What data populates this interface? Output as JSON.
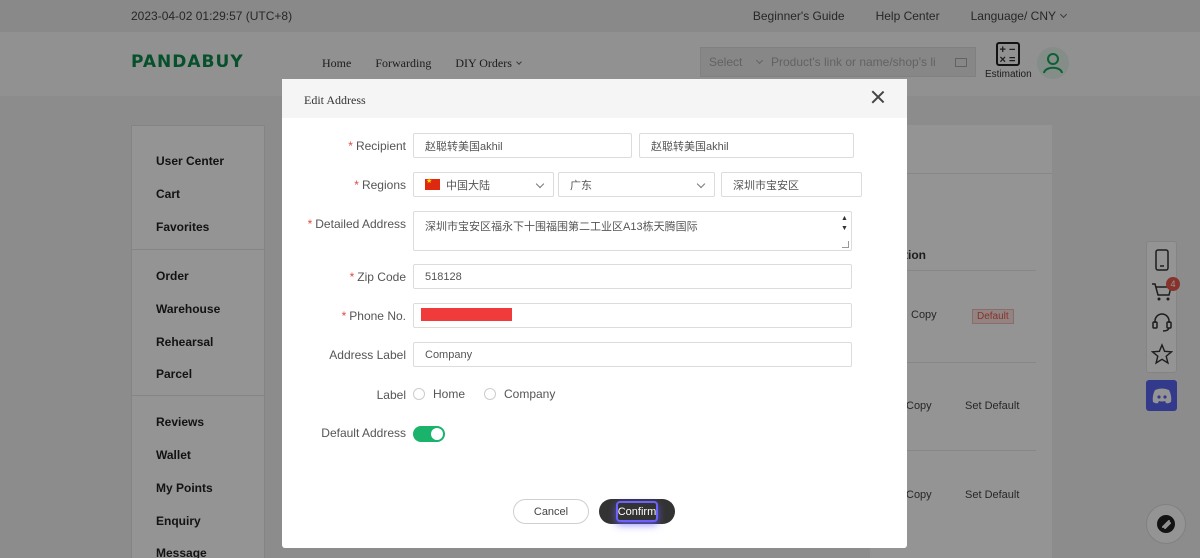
{
  "topbar": {
    "datetime": "2023-04-02 01:29:57 (UTC+8)",
    "beginners_guide": "Beginner's Guide",
    "help_center": "Help Center",
    "language": "Language/ CNY"
  },
  "header": {
    "logo": "PANDABUY",
    "nav": {
      "home": "Home",
      "forwarding": "Forwarding",
      "diy_orders": "DIY Orders"
    },
    "search": {
      "select": "Select",
      "placeholder": "Product's link or name/shop's li"
    },
    "estimation": "Estimation"
  },
  "sidebar": {
    "items": [
      "User Center",
      "Cart",
      "Favorites",
      "Order",
      "Warehouse",
      "Rehearsal",
      "Parcel",
      "Reviews",
      "Wallet",
      "My Points",
      "Enquiry",
      "Message"
    ]
  },
  "background_table": {
    "column_header": "tion",
    "rows": [
      {
        "copy": "Copy",
        "action": "Default"
      },
      {
        "copy": "Copy",
        "action": "Set Default"
      },
      {
        "copy": "Copy",
        "action": "Set Default"
      }
    ]
  },
  "floating_tools": {
    "cart_count": "4",
    "icons": [
      "mobile-icon",
      "cart-icon",
      "support-icon",
      "star-icon",
      "discord-icon",
      "chat-icon"
    ]
  },
  "modal": {
    "title": "Edit Address",
    "required_mark": "*",
    "recipient": {
      "label": "Recipient",
      "first_value": "赵聪转美国akhil",
      "second_value": "赵聪转美国akhil"
    },
    "regions": {
      "label": "Regions",
      "country": "中国大陆",
      "province": "广东",
      "district": "深圳市宝安区"
    },
    "detailed_address": {
      "label": "Detailed Address",
      "value": "深圳市宝安区福永下十围福围第二工业区A13栋天腾国际"
    },
    "zip_code": {
      "label": "Zip Code",
      "value": "518128"
    },
    "phone": {
      "label": "Phone No."
    },
    "address_label": {
      "label": "Address Label",
      "value": "Company"
    },
    "label_choice": {
      "label": "Label",
      "options": [
        "Home",
        "Company"
      ]
    },
    "default_address": {
      "label": "Default Address",
      "enabled": true
    },
    "cancel": "Cancel",
    "confirm": "Confirm"
  }
}
